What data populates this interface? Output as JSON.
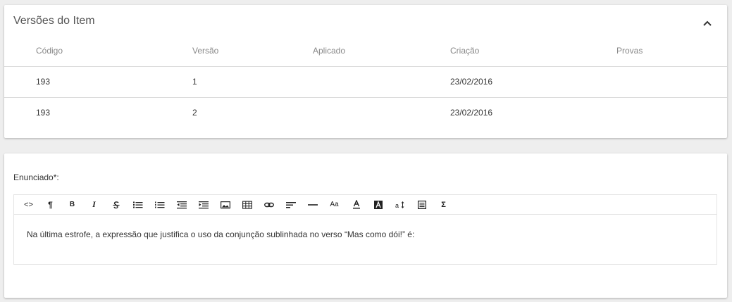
{
  "versions_panel": {
    "title": "Versões do Item",
    "columns": [
      "Código",
      "Versão",
      "Aplicado",
      "Criação",
      "Provas"
    ],
    "rows": [
      {
        "codigo": "193",
        "versao": "1",
        "aplicado": "",
        "criacao": "23/02/2016",
        "provas": ""
      },
      {
        "codigo": "193",
        "versao": "2",
        "aplicado": "",
        "criacao": "23/02/2016",
        "provas": ""
      }
    ]
  },
  "statement_panel": {
    "label": "Enunciado*:",
    "toolbar": {
      "code": "<>",
      "paragraph": "¶",
      "bold": "B",
      "italic": "I",
      "font_size": "Aa",
      "sigma": "Σ"
    },
    "content": "Na última estrofe, a expressão que justifica o uso da conjunção sublinhada no verso “Mas como dói!” é:"
  }
}
